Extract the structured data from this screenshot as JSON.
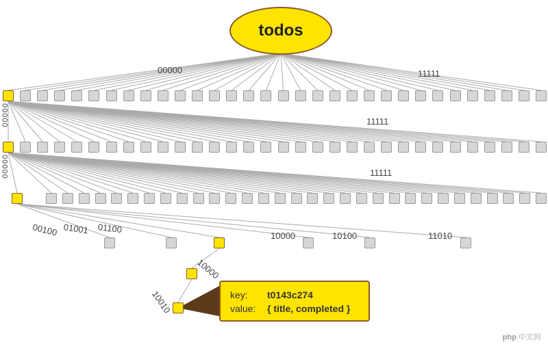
{
  "root": {
    "label": "todos"
  },
  "level1": {
    "left_label": "00000",
    "right_label": "11111",
    "left_side_label": "00000",
    "count": 32,
    "highlighted_index": 0
  },
  "level2": {
    "right_label": "11111",
    "left_side_label": "00000",
    "count": 32,
    "highlighted_index": 0
  },
  "level3": {
    "right_label": "11111",
    "count": 32,
    "highlighted_index": 0
  },
  "level4": {
    "labels": [
      "00100",
      "01001",
      "01100",
      "10000",
      "10100",
      "11010"
    ],
    "highlighted_label_index": 2,
    "count": 6
  },
  "path_labels": {
    "p1": "10000",
    "p2": "10010"
  },
  "leaf": {
    "key_label": "key:",
    "key_value": "t0143c274",
    "value_label": "value:",
    "value_value": "{ title, completed }"
  },
  "watermark": {
    "brand": "php",
    "suffix": "中文网"
  }
}
